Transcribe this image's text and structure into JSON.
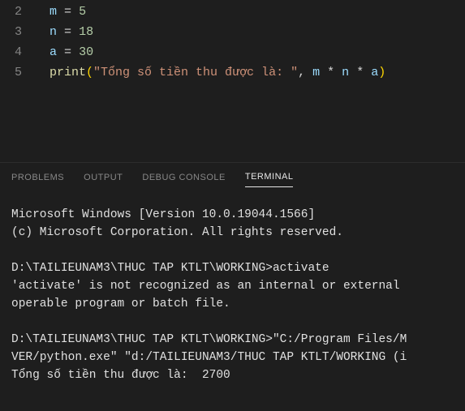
{
  "editor": {
    "lines": [
      {
        "num": "2",
        "tokens": [
          {
            "t": "var",
            "v": "m"
          },
          {
            "t": "sp",
            "v": " "
          },
          {
            "t": "op",
            "v": "="
          },
          {
            "t": "sp",
            "v": " "
          },
          {
            "t": "num",
            "v": "5"
          }
        ]
      },
      {
        "num": "3",
        "tokens": [
          {
            "t": "var",
            "v": "n"
          },
          {
            "t": "sp",
            "v": " "
          },
          {
            "t": "op",
            "v": "="
          },
          {
            "t": "sp",
            "v": " "
          },
          {
            "t": "num",
            "v": "18"
          }
        ]
      },
      {
        "num": "4",
        "tokens": [
          {
            "t": "var",
            "v": "a"
          },
          {
            "t": "sp",
            "v": " "
          },
          {
            "t": "op",
            "v": "="
          },
          {
            "t": "sp",
            "v": " "
          },
          {
            "t": "num",
            "v": "30"
          }
        ]
      },
      {
        "num": "5",
        "tokens": [
          {
            "t": "fn",
            "v": "print"
          },
          {
            "t": "paren",
            "v": "("
          },
          {
            "t": "str",
            "v": "\"Tổng số tiền thu được là: \""
          },
          {
            "t": "punct",
            "v": ", "
          },
          {
            "t": "var",
            "v": "m"
          },
          {
            "t": "sp",
            "v": " "
          },
          {
            "t": "op",
            "v": "*"
          },
          {
            "t": "sp",
            "v": " "
          },
          {
            "t": "var",
            "v": "n"
          },
          {
            "t": "sp",
            "v": " "
          },
          {
            "t": "op",
            "v": "*"
          },
          {
            "t": "sp",
            "v": " "
          },
          {
            "t": "var",
            "v": "a"
          },
          {
            "t": "paren",
            "v": ")"
          }
        ]
      }
    ]
  },
  "panel": {
    "tabs": [
      {
        "id": "problems",
        "label": "PROBLEMS",
        "active": false
      },
      {
        "id": "output",
        "label": "OUTPUT",
        "active": false
      },
      {
        "id": "debugconsole",
        "label": "DEBUG CONSOLE",
        "active": false
      },
      {
        "id": "terminal",
        "label": "TERMINAL",
        "active": true
      }
    ]
  },
  "terminal": {
    "lines": [
      "Microsoft Windows [Version 10.0.19044.1566]",
      "(c) Microsoft Corporation. All rights reserved.",
      "",
      "D:\\TAILIEUNAM3\\THUC TAP KTLT\\WORKING>activate",
      "'activate' is not recognized as an internal or external",
      "operable program or batch file.",
      "",
      "D:\\TAILIEUNAM3\\THUC TAP KTLT\\WORKING>\"C:/Program Files/M",
      "VER/python.exe\" \"d:/TAILIEUNAM3/THUC TAP KTLT/WORKING (i",
      "Tổng số tiền thu được là:  2700"
    ]
  }
}
